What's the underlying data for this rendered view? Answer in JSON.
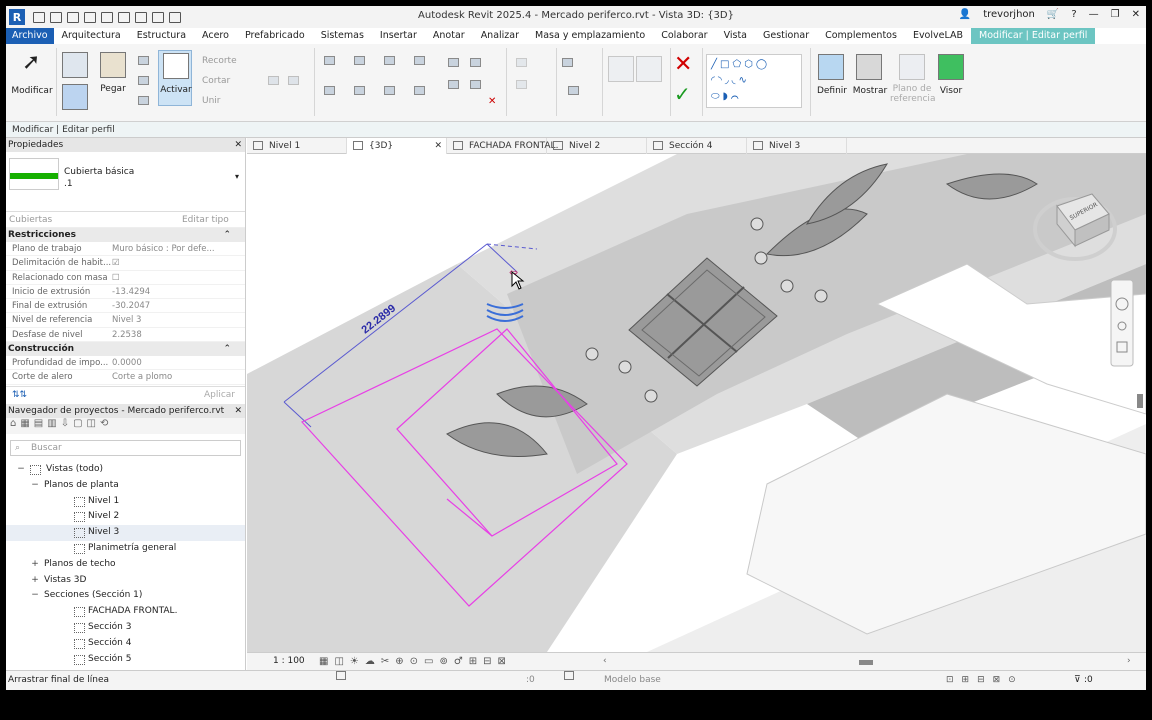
{
  "window": {
    "title": "Autodesk Revit 2025.4 - Mercado periferco.rvt - Vista 3D: {3D}",
    "user": "trevorjhon"
  },
  "menu": [
    "Archivo",
    "Arquitectura",
    "Estructura",
    "Acero",
    "Prefabricado",
    "Sistemas",
    "Insertar",
    "Anotar",
    "Analizar",
    "Masa y emplazamiento",
    "Colaborar",
    "Vista",
    "Gestionar",
    "Complementos",
    "EvolveLAB",
    "Modificar | Editar perfil"
  ],
  "ribbon": {
    "modificar": "Modificar",
    "pegar": "Pegar",
    "activar": "Activar",
    "recorte": "Recorte",
    "cortar": "Cortar",
    "unir": "Unir",
    "definir": "Definir",
    "mostrar": "Mostrar",
    "plano_ref": "Plano de referencia",
    "visor": "Visor"
  },
  "context_bar": "Modificar | Editar perfil",
  "properties": {
    "title": "Propiedades",
    "type_name": "Cubierta básica",
    "type_sub": ".1",
    "category": "Cubiertas",
    "edit_type": "Editar tipo",
    "sections": [
      {
        "name": "Restricciones",
        "rows": [
          {
            "k": "Plano de trabajo",
            "v": "Muro básico : Por defe..."
          },
          {
            "k": "Delimitación de habit...",
            "v": "☑"
          },
          {
            "k": "Relacionado con masa",
            "v": "☐"
          },
          {
            "k": "Inicio de extrusión",
            "v": "-13.4294"
          },
          {
            "k": "Final de extrusión",
            "v": "-30.2047"
          },
          {
            "k": "Nivel de referencia",
            "v": "Nivel 3"
          },
          {
            "k": "Desfase de nivel",
            "v": "2.2538"
          }
        ]
      },
      {
        "name": "Construcción",
        "rows": [
          {
            "k": "Profundidad de impo...",
            "v": "0.0000"
          },
          {
            "k": "Corte de alero",
            "v": "Corte a plomo"
          }
        ]
      }
    ],
    "apply": "Aplicar"
  },
  "browser": {
    "title": "Navegador de proyectos - Mercado periferco.rvt",
    "search_placeholder": "Buscar",
    "tree": [
      {
        "label": "Vistas (todo)",
        "level": 0,
        "toggle": "−",
        "icon": true
      },
      {
        "label": "Planos de planta",
        "level": 1,
        "toggle": "−",
        "icon": false
      },
      {
        "label": "Nivel 1",
        "level": 2,
        "toggle": "",
        "icon": true
      },
      {
        "label": "Nivel 2",
        "level": 2,
        "toggle": "",
        "icon": true
      },
      {
        "label": "Nivel 3",
        "level": 2,
        "toggle": "",
        "icon": true,
        "selected": true
      },
      {
        "label": "Planimetría general",
        "level": 2,
        "toggle": "",
        "icon": true
      },
      {
        "label": "Planos de techo",
        "level": 1,
        "toggle": "+",
        "icon": false
      },
      {
        "label": "Vistas 3D",
        "level": 1,
        "toggle": "+",
        "icon": false
      },
      {
        "label": "Secciones (Sección 1)",
        "level": 1,
        "toggle": "−",
        "icon": false
      },
      {
        "label": "FACHADA FRONTAL.",
        "level": 2,
        "toggle": "",
        "icon": true
      },
      {
        "label": "Sección 3",
        "level": 2,
        "toggle": "",
        "icon": true
      },
      {
        "label": "Sección 4",
        "level": 2,
        "toggle": "",
        "icon": true
      },
      {
        "label": "Sección 5",
        "level": 2,
        "toggle": "",
        "icon": true
      }
    ]
  },
  "view_tabs": [
    {
      "label": "Nivel 1",
      "active": false
    },
    {
      "label": "{3D}",
      "active": true
    },
    {
      "label": "FACHADA FRONTAL.",
      "active": false
    },
    {
      "label": "Nivel 2",
      "active": false
    },
    {
      "label": "Sección 4",
      "active": false
    },
    {
      "label": "Nivel 3",
      "active": false
    }
  ],
  "viewport": {
    "dimension": "22.2899",
    "viewcube_label": "SUPERIOR"
  },
  "view_footer": {
    "scale": "1 : 100"
  },
  "status": {
    "message": "Arrastrar final de línea",
    "worksets": ":0",
    "model": "Modelo base",
    "filter": ":0"
  },
  "colors": {
    "accent": "#1b5fb4",
    "context_tab": "#6cc5c2",
    "sketch": "#e83fe6",
    "dimension": "#2a2aa8"
  }
}
